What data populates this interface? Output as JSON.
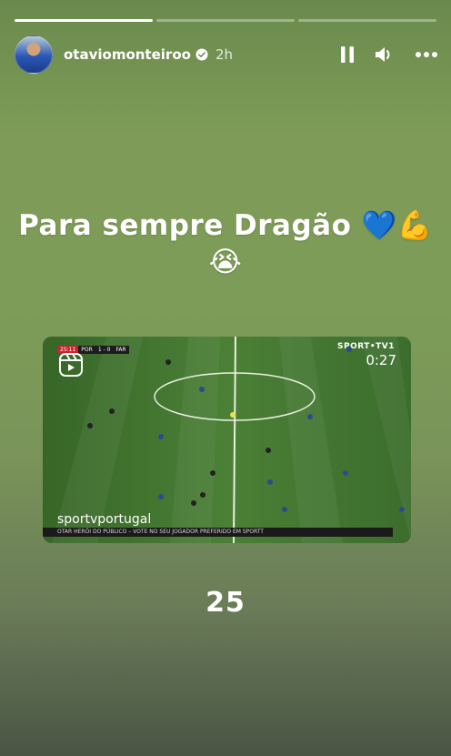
{
  "story": {
    "progress": [
      1.0,
      0.0,
      0.0
    ],
    "progress_color": "#ffffff",
    "username": "otaviomonteiroo",
    "time": "2h",
    "verified_color": "#ffffff"
  },
  "icons": {
    "pause": "pause-icon",
    "volume": "volume-icon",
    "more": "more-icon",
    "verified": "verified-badge-icon",
    "reel": "reel-icon"
  },
  "caption": {
    "line1": "Para sempre Dragão 💙💪",
    "line2": "😭"
  },
  "video": {
    "source_label": "sportvportugal",
    "timer": "0:27",
    "channel": "SPORT•TV1",
    "score": [
      "25:11",
      "POR",
      "1 - 0",
      "FAR"
    ],
    "ticker": "OTAR   HERÓI DO PÚBLICO – VOTE NO SEU JOGADOR PREFERIDO EM SPORTT"
  },
  "number": "25"
}
